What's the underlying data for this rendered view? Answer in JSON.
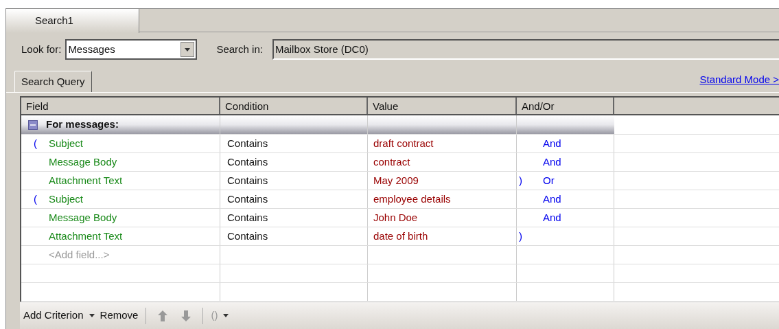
{
  "tabs": [
    {
      "label": "Search1",
      "selected": true
    }
  ],
  "look_for": {
    "label": "Look for:",
    "value": "Messages"
  },
  "search_in": {
    "label": "Search in:",
    "value": "Mailbox Store (DC0)"
  },
  "query_tabs": [
    {
      "label": "Search Query",
      "selected": true
    }
  ],
  "mode_link": "Standard Mode >",
  "table": {
    "columns": [
      "Field",
      "Condition",
      "Value",
      "And/Or"
    ],
    "group": {
      "label": "For messages:",
      "expanded": true
    },
    "rows": [
      {
        "open_paren": "(",
        "field": "Subject",
        "condition": "Contains",
        "value": "draft contract",
        "close_paren": "",
        "and_or": "And"
      },
      {
        "open_paren": "",
        "field": "Message Body",
        "condition": "Contains",
        "value": "contract",
        "close_paren": "",
        "and_or": "And"
      },
      {
        "open_paren": "",
        "field": "Attachment Text",
        "condition": "Contains",
        "value": "May 2009",
        "close_paren": ")",
        "and_or": "Or"
      },
      {
        "open_paren": "(",
        "field": "Subject",
        "condition": "Contains",
        "value": "employee details",
        "close_paren": "",
        "and_or": "And"
      },
      {
        "open_paren": "",
        "field": "Message Body",
        "condition": "Contains",
        "value": "John Doe",
        "close_paren": "",
        "and_or": "And"
      },
      {
        "open_paren": "",
        "field": "Attachment Text",
        "condition": "Contains",
        "value": "date of birth",
        "close_paren": ")",
        "and_or": ""
      }
    ],
    "add_row": {
      "placeholder": "<Add field...>"
    }
  },
  "toolbar": [
    {
      "kind": "dropdown",
      "label": "Add Criterion"
    },
    {
      "kind": "button",
      "label": "Remove"
    },
    {
      "kind": "separator"
    },
    {
      "kind": "up"
    },
    {
      "kind": "down"
    },
    {
      "kind": "separator"
    },
    {
      "kind": "paren_dropdown",
      "label": "()"
    }
  ]
}
